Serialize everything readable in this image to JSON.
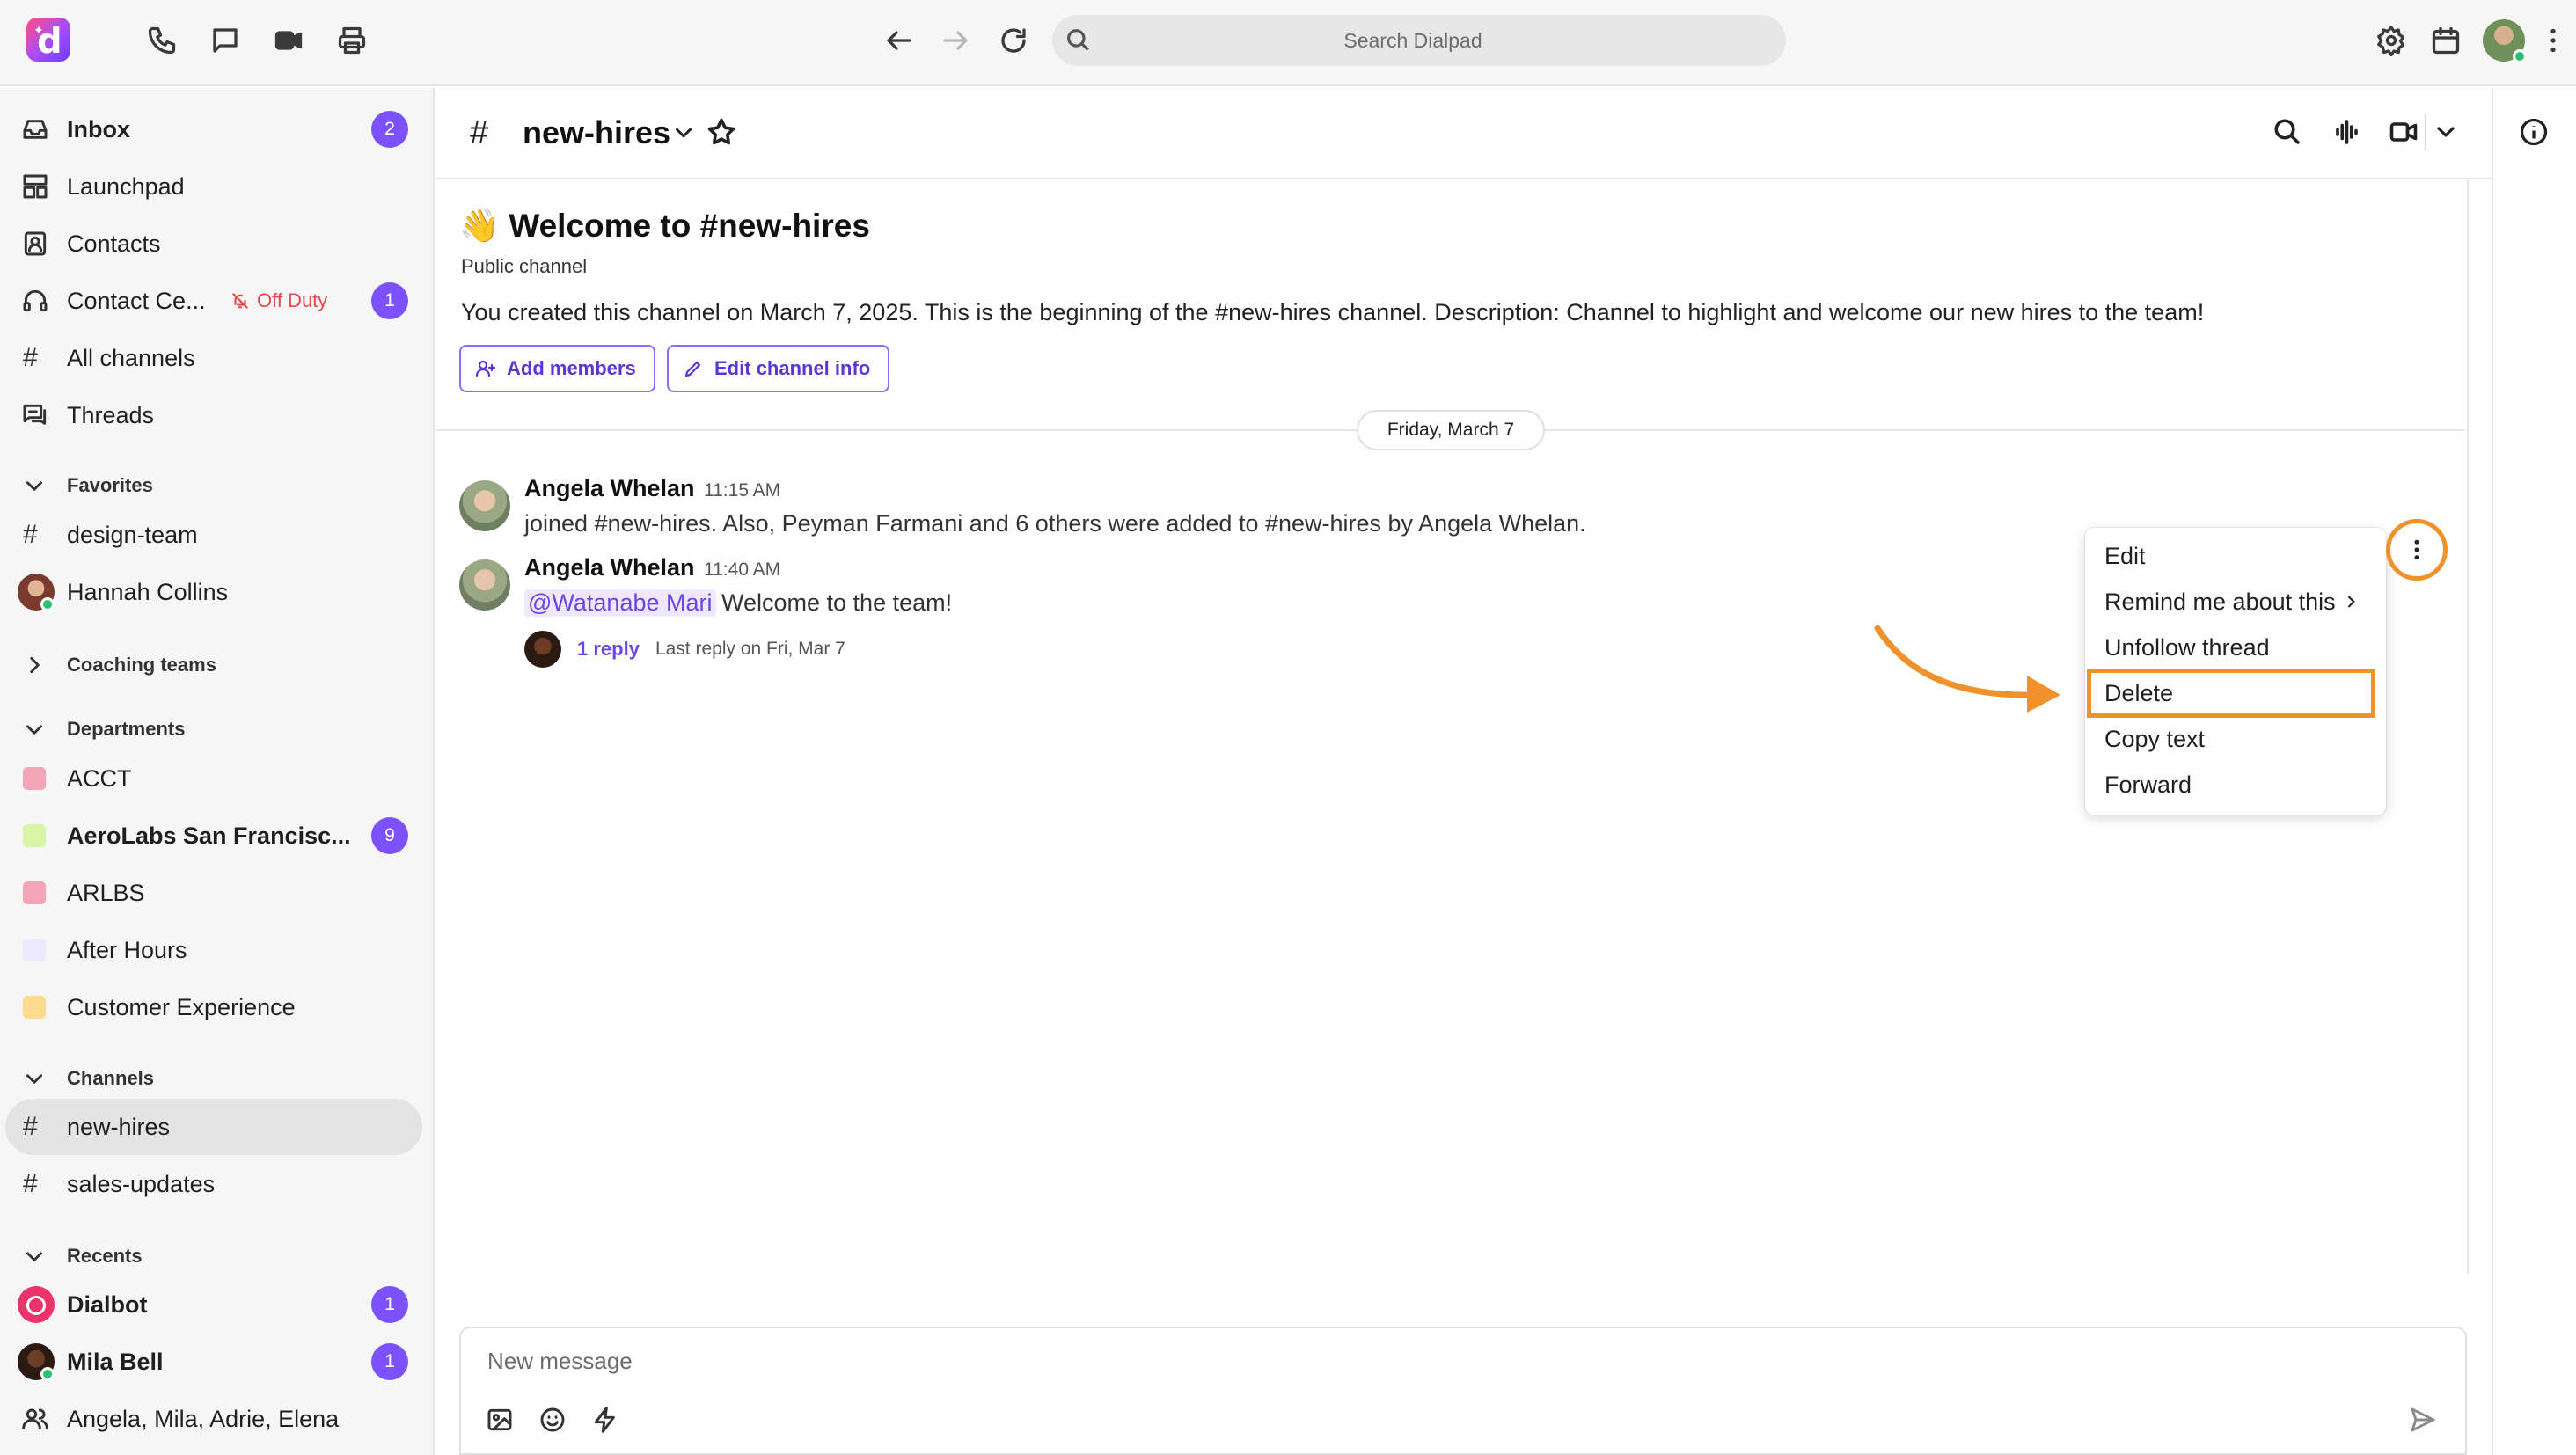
{
  "search": {
    "placeholder": "Search Dialpad"
  },
  "sidebar": {
    "top_items": [
      {
        "label": "Inbox",
        "badge": "2"
      },
      {
        "label": "Launchpad"
      },
      {
        "label": "Contacts"
      },
      {
        "label": "Contact Ce...",
        "status": "Off Duty",
        "badge": "1"
      },
      {
        "label": "All channels"
      },
      {
        "label": "Threads"
      }
    ],
    "favorites": {
      "header": "Favorites",
      "items": [
        "design-team",
        "Hannah Collins"
      ]
    },
    "coaching": {
      "header": "Coaching teams"
    },
    "departments": {
      "header": "Departments",
      "items": [
        {
          "label": "ACCT",
          "color": "#f4a6b8"
        },
        {
          "label": "AeroLabs San Francisc...",
          "color": "#d8f5a8",
          "badge": "9"
        },
        {
          "label": "ARLBS",
          "color": "#f4a6b8"
        },
        {
          "label": "After Hours",
          "color": "#eceaff"
        },
        {
          "label": "Customer Experience",
          "color": "#fbdc8e"
        }
      ]
    },
    "channels": {
      "header": "Channels",
      "items": [
        "new-hires",
        "sales-updates"
      ]
    },
    "recents": {
      "header": "Recents",
      "items": [
        {
          "label": "Dialbot",
          "badge": "1"
        },
        {
          "label": "Mila Bell",
          "badge": "1"
        },
        {
          "label": "Angela, Mila, Adrie, Elena"
        }
      ]
    }
  },
  "channel": {
    "name": "new-hires",
    "welcome_title": "👋 Welcome to #new-hires",
    "type_label": "Public channel",
    "description": "You created this channel on March 7, 2025. This is the beginning of the #new-hires channel. Description: Channel to highlight and welcome our new hires to the team!",
    "add_members": "Add members",
    "edit_info": "Edit channel info",
    "date_divider": "Friday, March 7"
  },
  "messages": [
    {
      "author": "Angela Whelan",
      "time": "11:15 AM",
      "text": "joined #new-hires. Also, Peyman Farmani and 6 others were added to #new-hires by Angela Whelan."
    },
    {
      "author": "Angela Whelan",
      "time": "11:40 AM",
      "mention": "@Watanabe Mari",
      "text": "Welcome to the team!",
      "reply_count": "1 reply",
      "last_reply": "Last reply on Fri, Mar 7"
    }
  ],
  "context_menu": {
    "items": [
      "Edit",
      "Remind me about this",
      "Unfollow thread",
      "Delete",
      "Copy text",
      "Forward"
    ],
    "highlighted": "Delete"
  },
  "composer": {
    "placeholder": "New message"
  },
  "colors": {
    "accent": "#7c52ff",
    "highlight": "#f0922c",
    "off_duty": "#e5484d"
  }
}
